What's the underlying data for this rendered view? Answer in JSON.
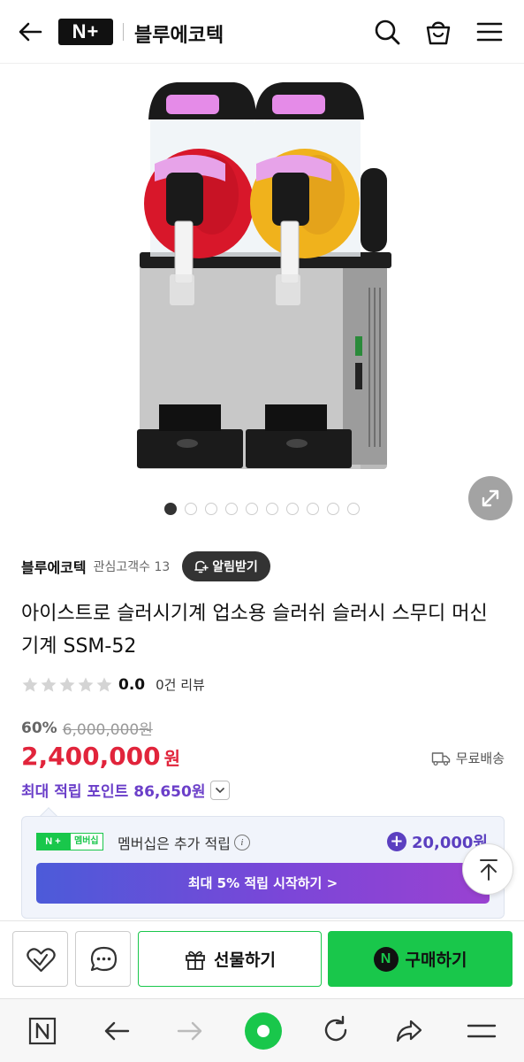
{
  "header": {
    "logo_text": "N+",
    "store_name": "블루에코텍"
  },
  "gallery": {
    "total_images": 10,
    "active_index": 0
  },
  "seller": {
    "name": "블루에코텍",
    "followers": "관심고객수 13",
    "alarm_label": "알림받기"
  },
  "product": {
    "title": "아이스트로 슬러시기계 업소용 슬러쉬 슬러시 스무디 머신 기계 SSM-52",
    "rating": "0.0",
    "review_count": "0건 리뷰",
    "discount_percent": "60%",
    "original_price": "6,000,000원",
    "price": "2,400,000",
    "currency": "원",
    "shipping": "무료배송",
    "max_points": "최대 적립 포인트 86,650원"
  },
  "membership": {
    "badge_np": "N +",
    "badge_label": "멤버십",
    "text": "멤버십은 추가 적립",
    "info_icon": "i",
    "amount": "20,000원",
    "cta": "최대 5% 적립 시작하기 >"
  },
  "actions": {
    "gift_label": "선물하기",
    "buy_label": "구매하기",
    "buy_icon_text": "N"
  },
  "colors": {
    "naver_green": "#19c74b",
    "price_red": "#e1243b",
    "point_purple": "#6b3fc9"
  },
  "icons": {
    "header": [
      "back-arrow-icon",
      "search-icon",
      "cart-icon",
      "menu-icon"
    ],
    "browser": [
      "naver-n-icon",
      "back-icon",
      "forward-icon",
      "home-green-icon",
      "refresh-icon",
      "share-icon",
      "menu-icon"
    ]
  }
}
